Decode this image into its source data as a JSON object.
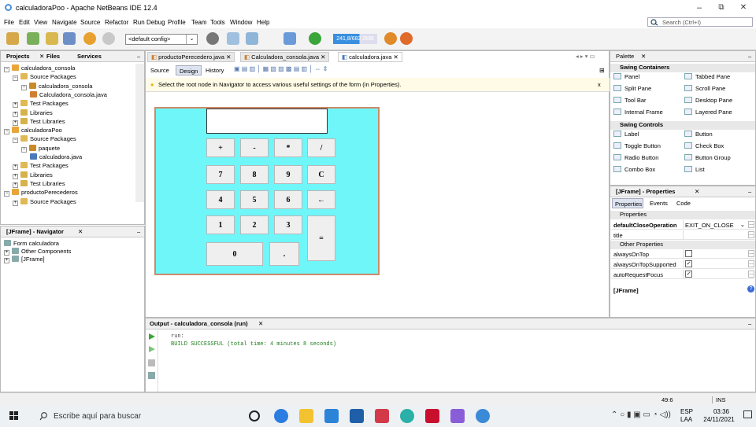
{
  "window": {
    "title": "calculadoraPoo - Apache NetBeans IDE 12.4",
    "controls": [
      "–",
      "⧉",
      "✕"
    ]
  },
  "menu": [
    "File",
    "Edit",
    "View",
    "Navigate",
    "Source",
    "Refactor",
    "Run",
    "Debug",
    "Profile",
    "Team",
    "Tools",
    "Window",
    "Help"
  ],
  "search": {
    "placeholder": "Search (Ctrl+I)"
  },
  "toolbar": {
    "config": "<default config>",
    "memory": "241,8/682,0MB"
  },
  "projects": {
    "tabs": [
      "Projects",
      "Files",
      "Services"
    ],
    "tree": [
      {
        "label": "calculadora_consola",
        "indent": 0,
        "exp": "−",
        "icon": "project"
      },
      {
        "label": "Source Packages",
        "indent": 1,
        "exp": "−",
        "icon": "folder"
      },
      {
        "label": "calculadora_consola",
        "indent": 2,
        "exp": "−",
        "icon": "package"
      },
      {
        "label": "Calculadora_consola.java",
        "indent": 3,
        "exp": "",
        "icon": "java"
      },
      {
        "label": "Test Packages",
        "indent": 1,
        "exp": "+",
        "icon": "folder"
      },
      {
        "label": "Libraries",
        "indent": 1,
        "exp": "+",
        "icon": "library"
      },
      {
        "label": "Test Libraries",
        "indent": 1,
        "exp": "+",
        "icon": "library"
      },
      {
        "label": "calculadoraPoo",
        "indent": 0,
        "exp": "−",
        "icon": "project"
      },
      {
        "label": "Source Packages",
        "indent": 1,
        "exp": "−",
        "icon": "folder"
      },
      {
        "label": "paquete",
        "indent": 2,
        "exp": "−",
        "icon": "package"
      },
      {
        "label": "calculadora.java",
        "indent": 3,
        "exp": "",
        "icon": "form"
      },
      {
        "label": "Test Packages",
        "indent": 1,
        "exp": "+",
        "icon": "folder"
      },
      {
        "label": "Libraries",
        "indent": 1,
        "exp": "+",
        "icon": "library"
      },
      {
        "label": "Test Libraries",
        "indent": 1,
        "exp": "+",
        "icon": "library"
      },
      {
        "label": "productoPerecederos",
        "indent": 0,
        "exp": "−",
        "icon": "project"
      },
      {
        "label": "Source Packages",
        "indent": 1,
        "exp": "+",
        "icon": "folder"
      }
    ]
  },
  "navigator": {
    "title": "[JFrame] - Navigator",
    "tree": [
      {
        "label": "Form calculadora",
        "indent": 0,
        "exp": ""
      },
      {
        "label": "Other Components",
        "indent": 0,
        "exp": "+"
      },
      {
        "label": "[JFrame]",
        "indent": 0,
        "exp": "+"
      }
    ]
  },
  "editor": {
    "tabs": [
      "productoPerecedero.java",
      "Calculadora_consola.java",
      "calculadora.java"
    ],
    "subtabs": [
      "Source",
      "Design",
      "History"
    ],
    "hint": "Select the root node in Navigator to access various useful settings of the form (in Properties).",
    "hint_close": "x"
  },
  "calculator": {
    "buttons": [
      "+",
      "-",
      "*",
      "/",
      "7",
      "8",
      "9",
      "C",
      "4",
      "5",
      "6",
      "←",
      "1",
      "2",
      "3",
      "=",
      "0",
      "."
    ]
  },
  "palette": {
    "title": "Palette",
    "sections": [
      {
        "name": "Swing Containers",
        "items": [
          "Panel",
          "Tabbed Pane",
          "Split Pane",
          "Scroll Pane",
          "Tool Bar",
          "Desktop Pane",
          "Internal Frame",
          "Layered Pane"
        ]
      },
      {
        "name": "Swing Controls",
        "items": [
          "Label",
          "Button",
          "Toggle Button",
          "Check Box",
          "Radio Button",
          "Button Group",
          "Combo Box",
          "List"
        ]
      }
    ]
  },
  "properties": {
    "title": "[JFrame] - Properties",
    "tabs": [
      "Properties",
      "Events",
      "Code"
    ],
    "section1": "Properties",
    "section2": "Other Properties",
    "rows": [
      {
        "key": "defaultCloseOperation",
        "value": "EXIT_ON_CLOSE",
        "kind": "select"
      },
      {
        "key": "title",
        "value": "",
        "kind": "text"
      },
      {
        "key": "alwaysOnTop",
        "value": "",
        "kind": "checkbox",
        "checked": false
      },
      {
        "key": "alwaysOnTopSupported",
        "value": "",
        "kind": "checkbox",
        "checked": true
      },
      {
        "key": "autoRequestFocus",
        "value": "",
        "kind": "checkbox",
        "checked": true
      }
    ],
    "footer": "[JFrame]"
  },
  "output": {
    "title": "Output - calculadora_consola (run)",
    "lines": [
      "run:",
      "BUILD SUCCESSFUL (total time: 4 minutes 8 seconds)"
    ]
  },
  "status": {
    "position": "49:6",
    "mode": "INS"
  },
  "taskbar": {
    "search_placeholder": "Escribe aquí para buscar",
    "lang": "ESP",
    "lang2": "LAA",
    "time": "03:36",
    "date": "24/11/2021"
  }
}
